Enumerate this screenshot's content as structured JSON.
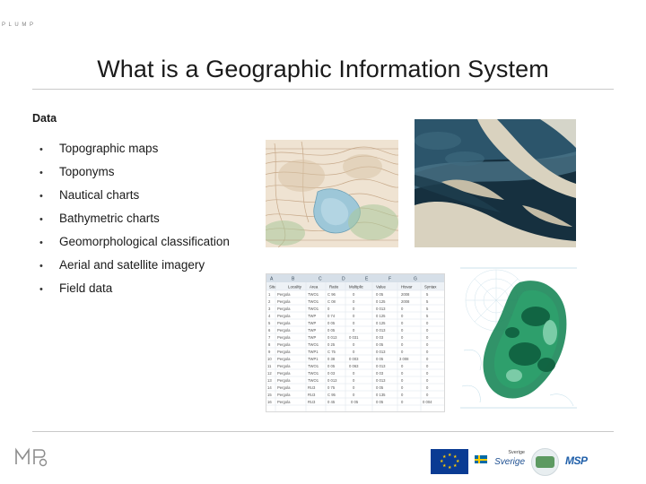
{
  "slide": {
    "title": "What is a Geographic Information System",
    "section_label": "Data",
    "bullet_marker": "•",
    "bullets": [
      "Topographic maps",
      "Toponyms",
      "Nautical charts",
      "Bathymetric charts",
      "Geomorphological classification",
      "Aerial and satellite imagery",
      "Field data"
    ]
  },
  "images": {
    "topographic_map": "topographic-map-thumbnail",
    "aerial_photo": "aerial-satellite-imagery-thumbnail",
    "attribute_table": "attribute-table-screenshot-thumbnail",
    "bathymetric_chart": "bathymetric-chart-thumbnail"
  },
  "table_preview": {
    "column_letters": [
      "A",
      "B",
      "C",
      "D",
      "E",
      "F",
      "G"
    ],
    "headers": [
      "Site",
      "Locality",
      "Area",
      "Ratio",
      "Multiplic",
      "Value",
      "Hisvar"
    ],
    "rows": [
      {
        "n": "1",
        "cells": [
          "Pergola",
          "TWO1",
          "C 96",
          "0",
          "0 05",
          "2008",
          "5"
        ]
      },
      {
        "n": "2",
        "cells": [
          "Pergola",
          "TWO1",
          "C 08",
          "0",
          "0 125",
          "2008",
          "5"
        ]
      },
      {
        "n": "3",
        "cells": [
          "Pergola",
          "TWO1",
          "0",
          "0",
          "0 013",
          "0",
          "5"
        ]
      },
      {
        "n": "4",
        "cells": [
          "Pergola",
          "TWP",
          "0 74",
          "0",
          "0 125",
          "0",
          "5"
        ]
      },
      {
        "n": "5",
        "cells": [
          "Pergola",
          "TWP",
          "0 05",
          "0",
          "0 125",
          "0",
          "0"
        ]
      },
      {
        "n": "6",
        "cells": [
          "Pergola",
          "TWP",
          "0 05",
          "0",
          "0 013",
          "0",
          "0"
        ]
      },
      {
        "n": "7",
        "cells": [
          "Pergola",
          "TWP",
          "0 013",
          "0 031",
          "0 03",
          "0",
          "0"
        ]
      },
      {
        "n": "8",
        "cells": [
          "Pergola",
          "TWO1",
          "0 25",
          "0",
          "0 05",
          "0",
          "0"
        ]
      },
      {
        "n": "9",
        "cells": [
          "Pergola",
          "TWP1",
          "C 75",
          "0",
          "0 013",
          "0",
          "0"
        ]
      },
      {
        "n": "10",
        "cells": [
          "Pergola",
          "TWP1",
          "0 38",
          "0 003",
          "0 05",
          "3 008",
          "0"
        ]
      },
      {
        "n": "11",
        "cells": [
          "Pergola",
          "TWO1",
          "0 05",
          "0 063",
          "0 013",
          "0",
          "0"
        ]
      },
      {
        "n": "12",
        "cells": [
          "Pergola",
          "TWO1",
          "0 03",
          "0",
          "0 03",
          "0",
          "0"
        ]
      },
      {
        "n": "13",
        "cells": [
          "Pergola",
          "TWO1",
          "0 013",
          "0",
          "0 013",
          "0",
          "0"
        ]
      },
      {
        "n": "14",
        "cells": [
          "Pergola",
          "RU3",
          "0 75",
          "0",
          "0 05",
          "0",
          "0"
        ]
      },
      {
        "n": "15",
        "cells": [
          "Pergola",
          "RU3",
          "C 95",
          "0",
          "0 135",
          "0",
          "0"
        ]
      },
      {
        "n": "16",
        "cells": [
          "Pergola",
          "RU3",
          "0 45",
          "0 05",
          "0 05",
          "0",
          "0 004"
        ]
      }
    ]
  },
  "footer_logos": {
    "left_logo_text": "P L U M P",
    "eu_flag": "eu-flag-logo",
    "sweden_logo_top": "Sverige",
    "sweden_logo_main": "Sverige",
    "round_logo": "institution-round-logo",
    "tail_logo_text": "MSP"
  }
}
